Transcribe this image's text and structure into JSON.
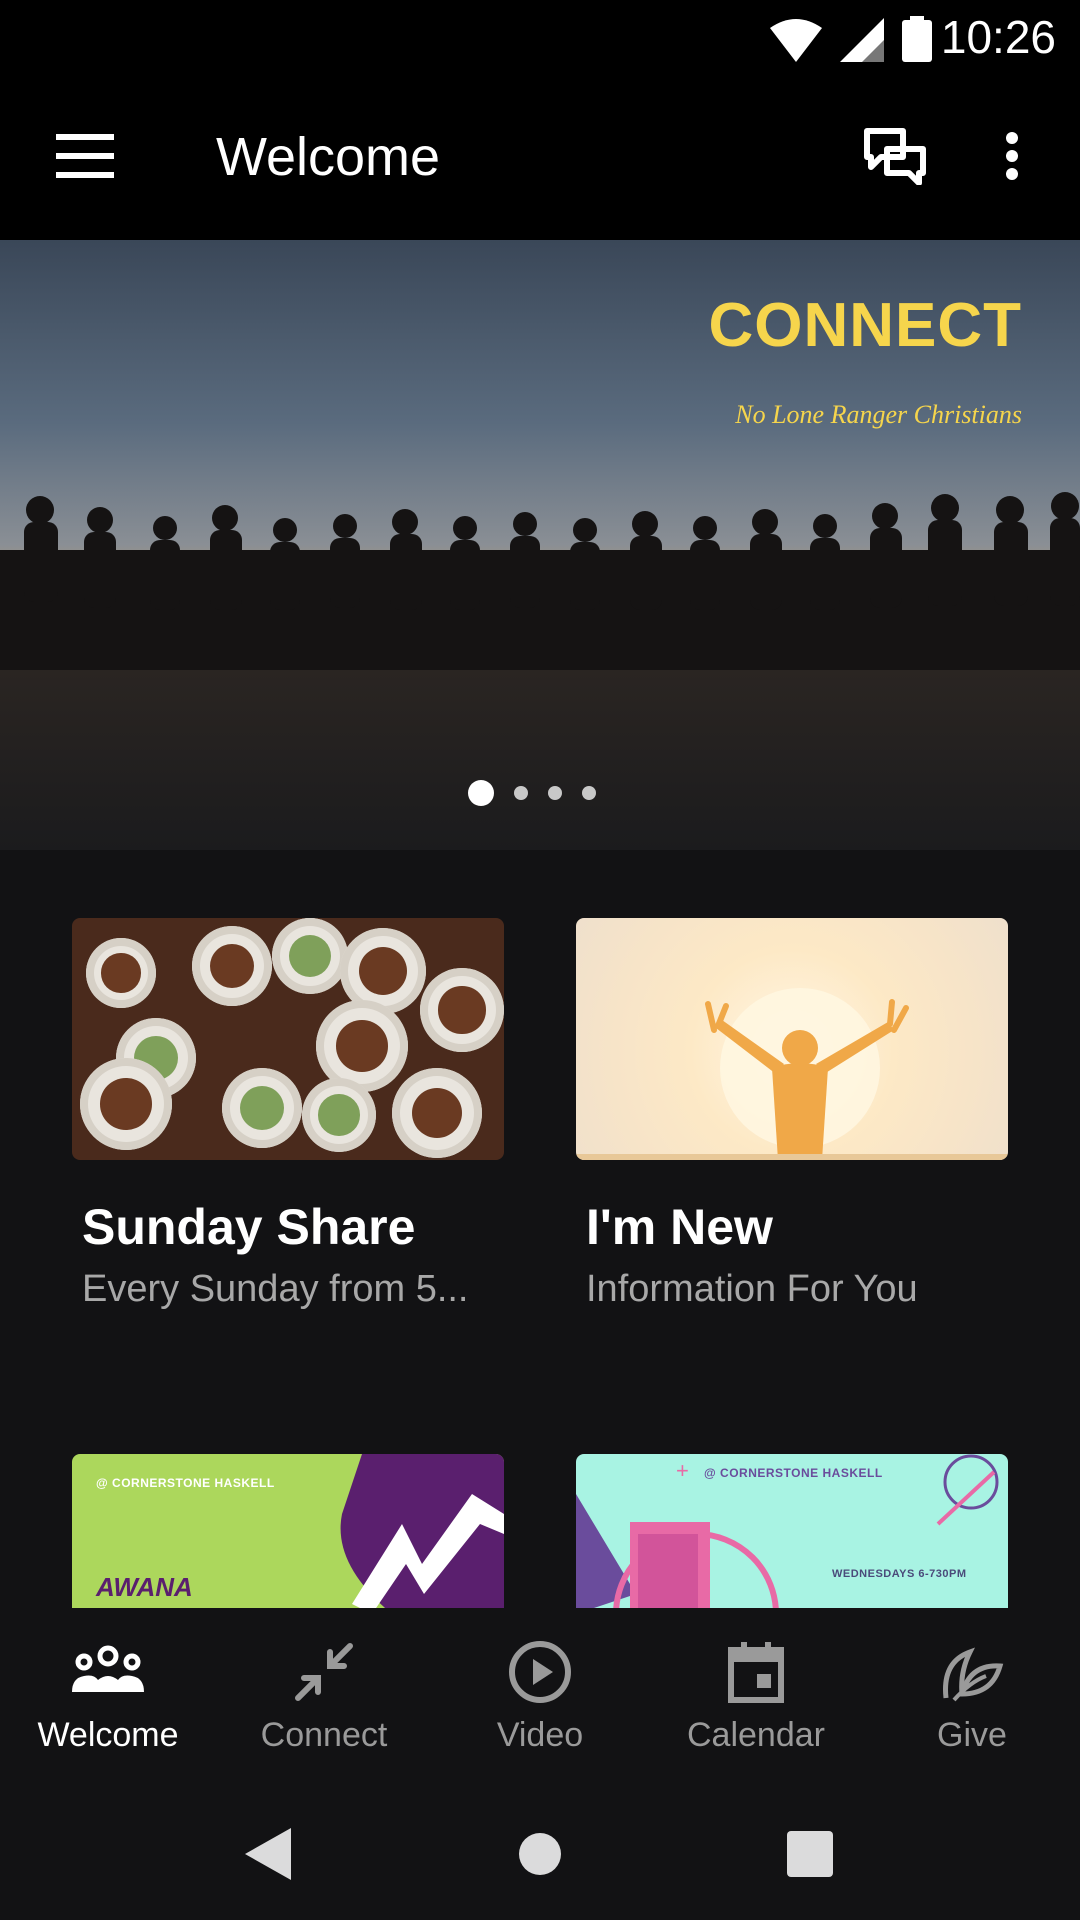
{
  "status_bar": {
    "time": "10:26"
  },
  "app_bar": {
    "title": "Welcome"
  },
  "hero": {
    "title": "CONNECT",
    "subtitle": "No Lone Ranger Christians",
    "page_count": 4,
    "active_page": 1
  },
  "cards": [
    {
      "title": "Sunday Share",
      "subtitle": "Every Sunday from 5..."
    },
    {
      "title": "I'm New",
      "subtitle": "Information For You"
    },
    {
      "promo_label": "@ CORNERSTONE HASKELL",
      "promo_title": "AWANA"
    },
    {
      "promo_label": "@ CORNERSTONE HASKELL",
      "promo_detail": "WEDNESDAYS 6-730PM"
    }
  ],
  "bottom_nav": {
    "items": [
      {
        "label": "Welcome",
        "icon": "people-icon"
      },
      {
        "label": "Connect",
        "icon": "compress-arrows-icon"
      },
      {
        "label": "Video",
        "icon": "play-circle-icon"
      },
      {
        "label": "Calendar",
        "icon": "calendar-icon"
      },
      {
        "label": "Give",
        "icon": "leaf-icon"
      }
    ],
    "active_index": 0
  },
  "colors": {
    "accent_yellow": "#f6d54c",
    "background": "#121214",
    "app_bar": "#000000"
  }
}
